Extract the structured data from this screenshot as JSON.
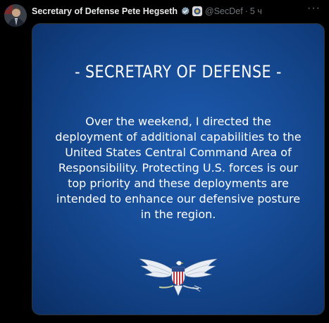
{
  "author": {
    "name": "Secretary of Defense Pete Hegseth",
    "handle": "@SecDef",
    "separator": "·",
    "time": "5 ч"
  },
  "menu": {
    "label": "···"
  },
  "icons": {
    "verified": "verified-badge-icon",
    "affiliation": "government-seal-icon",
    "emblem": "eagle-emblem-icon"
  },
  "card": {
    "title": "- SECRETARY OF DEFENSE -",
    "body": "Over the weekend, I directed the\ndeployment of additional capabilities to the\nUnited States Central Command Area of\nResponsibility. Protecting U.S. forces is our\ntop priority and these deployments are\nintended to enhance our defensive posture\nin the region."
  },
  "colors": {
    "background": "#000000",
    "card_blue": "#174d98",
    "muted_text": "#71767b",
    "primary_text": "#e7e9ea"
  }
}
